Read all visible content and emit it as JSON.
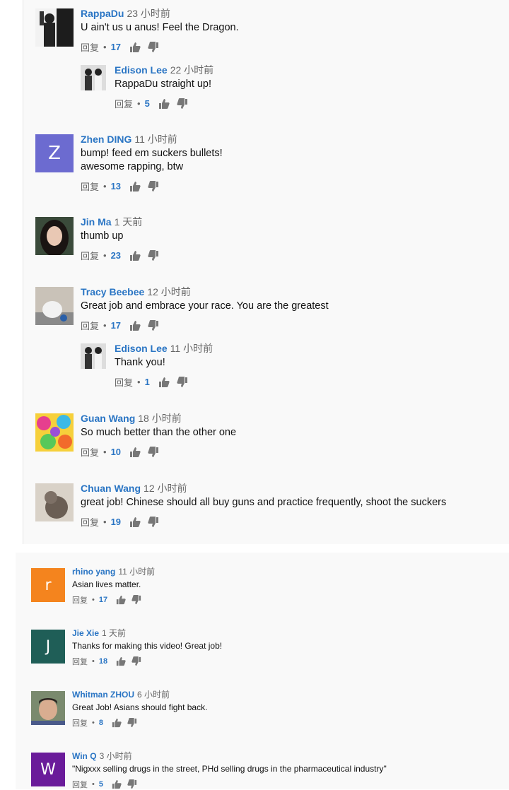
{
  "actions": {
    "reply": "回复",
    "dot": "•"
  },
  "comments": [
    {
      "author": "RappaDu",
      "time": "23 小时前",
      "text": [
        "U ain't us u anus! Feel the Dragon."
      ],
      "likes": "17",
      "avatar": "photo",
      "avatar_color": "#222222"
    },
    {
      "author": "Edison Lee",
      "time": "22 小时前",
      "text": [
        "RappaDu straight up!"
      ],
      "likes": "5",
      "avatar": "photo",
      "avatar_color": "#555555"
    },
    {
      "author": "Zhen DING",
      "time": "11 小时前",
      "text": [
        "bump! feed em suckers bullets!",
        "awesome rapping, btw"
      ],
      "likes": "13",
      "avatar_letter": "Z",
      "avatar_color": "#6c6bd0"
    },
    {
      "author": "Jin Ma",
      "time": "1 天前",
      "text": [
        "thumb up"
      ],
      "likes": "23",
      "avatar": "photo",
      "avatar_color": "#2f2a28"
    },
    {
      "author": "Tracy Beebee",
      "time": "12 小时前",
      "text": [
        "Great job and embrace your race. You are the greatest"
      ],
      "likes": "17",
      "avatar": "photo",
      "avatar_color": "#b8c2c6"
    },
    {
      "author": "Edison Lee",
      "time": "11 小时前",
      "text": [
        "Thank you!"
      ],
      "likes": "1",
      "avatar": "photo",
      "avatar_color": "#555555"
    },
    {
      "author": "Guan Wang",
      "time": "18 小时前",
      "text": [
        "So much better than the other one"
      ],
      "likes": "10",
      "avatar": "photo",
      "avatar_color": "#e0609a"
    },
    {
      "author": "Chuan Wang",
      "time": "12 小时前",
      "text": [
        "great job!  Chinese should all buy guns and practice frequently,  shoot the suckers"
      ],
      "likes": "19",
      "avatar": "photo",
      "avatar_color": "#9b8f84"
    },
    {
      "author": "rhino yang",
      "time": "11 小时前",
      "text": [
        "Asian lives matter."
      ],
      "likes": "17",
      "avatar_letter": "r",
      "avatar_color": "#f4841e"
    },
    {
      "author": "Jie Xie",
      "time": "1 天前",
      "text": [
        "Thanks for making this video! Great job!"
      ],
      "likes": "18",
      "avatar_letter": "J",
      "avatar_color": "#1f5e57"
    },
    {
      "author": "Whitman ZHOU",
      "time": "6 小时前",
      "text": [
        "Great Job! Asians should fight back."
      ],
      "likes": "8",
      "avatar": "photo",
      "avatar_color": "#c9a58a"
    },
    {
      "author": "Win Q",
      "time": "3 小时前",
      "text": [
        "\"Nigxxx selling drugs in the street, PHd selling drugs in the pharmaceutical industry\""
      ],
      "likes": "5",
      "avatar_letter": "W",
      "avatar_color": "#6a1b9a"
    }
  ]
}
